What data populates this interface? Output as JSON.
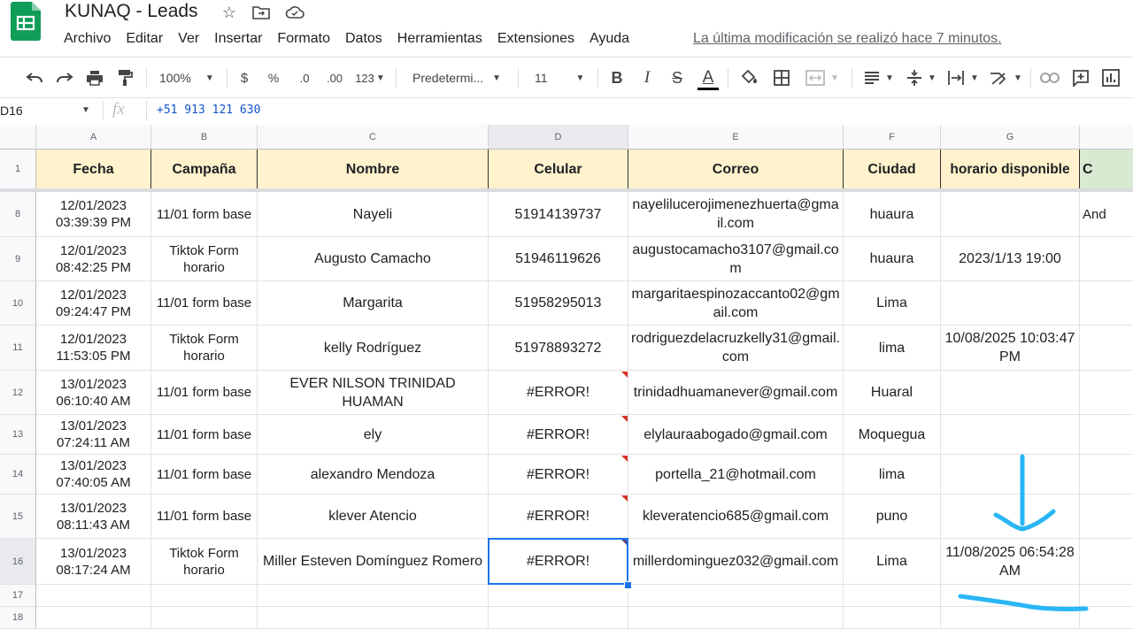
{
  "app": {
    "title": "KUNAQ - Leads",
    "last_modified": "La última modificación se realizó hace 7 minutos."
  },
  "menu": [
    "Archivo",
    "Editar",
    "Ver",
    "Insertar",
    "Formato",
    "Datos",
    "Herramientas",
    "Extensiones",
    "Ayuda"
  ],
  "toolbar": {
    "zoom": "100%",
    "currency": "$",
    "percent": "%",
    "dec_decrease": ".0",
    "dec_increase": ".00",
    "more_formats": "123",
    "font": "Predetermi...",
    "font_size": "11",
    "bold": "B",
    "italic": "I",
    "strike": "S",
    "text_color": "A"
  },
  "formula_bar": {
    "cell_ref": "D16",
    "fx": "fx",
    "value": "+51 913 121 630"
  },
  "columns": [
    "A",
    "B",
    "C",
    "D",
    "E",
    "F",
    "G",
    ""
  ],
  "header_row": {
    "row_number": "1",
    "cells": [
      "Fecha",
      "Campaña",
      "Nombre",
      "Celular",
      "Correo",
      "Ciudad",
      "horario disponible",
      "C"
    ]
  },
  "rows": [
    {
      "n": "8",
      "cells": [
        "12/01/2023 03:39:39 PM",
        "11/01 form base",
        "Nayeli",
        "51914139737",
        "nayelilucerojimenezhuerta@gmail.com",
        "huaura",
        "",
        "And"
      ]
    },
    {
      "n": "9",
      "cells": [
        "12/01/2023 08:42:25 PM",
        "Tiktok Form horario",
        "Augusto Camacho",
        "51946119626",
        "augustocamacho3107@gmail.com",
        "huaura",
        "2023/1/13 19:00",
        ""
      ]
    },
    {
      "n": "10",
      "cells": [
        "12/01/2023 09:24:47 PM",
        "11/01 form base",
        "Margarita",
        "51958295013",
        "margaritaespinozaccanto02@gmail.com",
        "Lima",
        "",
        ""
      ]
    },
    {
      "n": "11",
      "cells": [
        "12/01/2023 11:53:05 PM",
        "Tiktok Form horario",
        "kelly Rodríguez",
        "51978893272",
        "rodriguezdelacruzkelly31@gmail.com",
        "lima",
        "10/08/2025 10:03:47 PM",
        ""
      ]
    },
    {
      "n": "12",
      "cells": [
        "13/01/2023 06:10:40 AM",
        "11/01 form base",
        "EVER NILSON TRINIDAD HUAMAN",
        "#ERROR!",
        "trinidadhuamanever@gmail.com",
        "Huaral",
        "",
        ""
      ]
    },
    {
      "n": "13",
      "cells": [
        "13/01/2023 07:24:11 AM",
        "11/01 form base",
        "ely",
        "#ERROR!",
        "elylauraabogado@gmail.com",
        "Moquegua",
        "",
        ""
      ]
    },
    {
      "n": "14",
      "cells": [
        "13/01/2023 07:40:05 AM",
        "11/01 form base",
        "alexandro Mendoza",
        "#ERROR!",
        "portella_21@hotmail.com",
        "lima",
        "",
        ""
      ]
    },
    {
      "n": "15",
      "cells": [
        "13/01/2023 08:11:43 AM",
        "11/01 form base",
        "klever Atencio",
        "#ERROR!",
        "kleveratencio685@gmail.com",
        "puno",
        "",
        ""
      ]
    },
    {
      "n": "16",
      "cells": [
        "13/01/2023 08:17:24 AM",
        "Tiktok Form horario",
        "Miller Esteven Domínguez Romero",
        "#ERROR!",
        "millerdominguez032@gmail.com",
        "Lima",
        "11/08/2025 06:54:28 AM",
        ""
      ]
    },
    {
      "n": "17",
      "cells": [
        "",
        "",
        "",
        "",
        "",
        "",
        "",
        ""
      ]
    },
    {
      "n": "18",
      "cells": [
        "",
        "",
        "",
        "",
        "",
        "",
        "",
        ""
      ]
    }
  ],
  "colors": {
    "header_fill": "#fff2cc",
    "header_fill_alt": "#d9ead3",
    "selection": "#1a73e8",
    "annotation": "#29b6f6",
    "error_marker": "#d93025"
  }
}
